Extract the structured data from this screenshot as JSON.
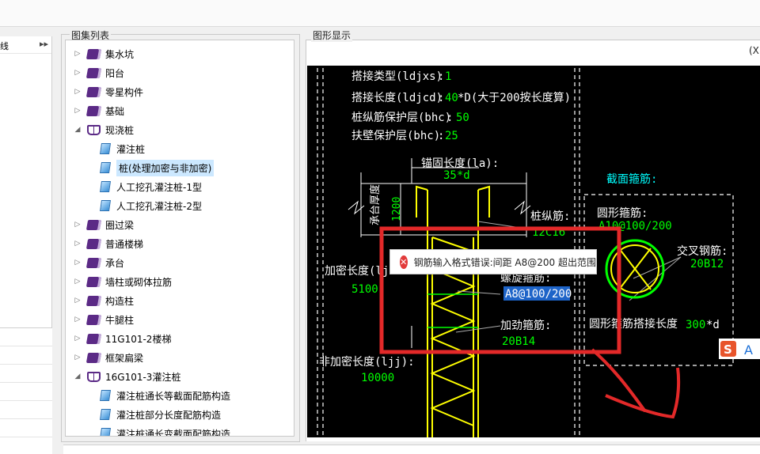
{
  "left_panel": {
    "label": "线",
    "arrow": "▸▸"
  },
  "tree_panel": {
    "title": "图集列表",
    "items": [
      {
        "label": "集水坑",
        "type": "folder",
        "expanded": false
      },
      {
        "label": "阳台",
        "type": "folder",
        "expanded": false
      },
      {
        "label": "零星构件",
        "type": "folder",
        "expanded": false
      },
      {
        "label": "基础",
        "type": "folder",
        "expanded": false
      },
      {
        "label": "现浇桩",
        "type": "folder",
        "expanded": true
      },
      {
        "label": "灌注桩",
        "type": "page"
      },
      {
        "label": "桩(处理加密与非加密)",
        "type": "page",
        "selected": true
      },
      {
        "label": "人工挖孔灌注桩-1型",
        "type": "page"
      },
      {
        "label": "人工挖孔灌注桩-2型",
        "type": "page"
      },
      {
        "label": "圈过梁",
        "type": "folder",
        "expanded": false
      },
      {
        "label": "普通楼梯",
        "type": "folder",
        "expanded": false
      },
      {
        "label": "承台",
        "type": "folder",
        "expanded": false
      },
      {
        "label": "墙柱或砌体拉筋",
        "type": "folder",
        "expanded": false
      },
      {
        "label": "构造柱",
        "type": "folder",
        "expanded": false
      },
      {
        "label": "牛腿柱",
        "type": "folder",
        "expanded": false
      },
      {
        "label": "11G101-2楼梯",
        "type": "folder",
        "expanded": false
      },
      {
        "label": "框架扁梁",
        "type": "folder",
        "expanded": false
      },
      {
        "label": "16G101-3灌注桩",
        "type": "folder",
        "expanded": true
      },
      {
        "label": "灌注桩通长等截面配筋构造",
        "type": "page"
      },
      {
        "label": "灌注桩部分长度配筋构造",
        "type": "page"
      },
      {
        "label": "灌注桩通长变截面配筋构造",
        "type": "page"
      }
    ]
  },
  "graphic_panel": {
    "title": "图形显示",
    "corner_label": "(X",
    "params": [
      {
        "label": "搭接类型(ldjxs)",
        "sep": ":",
        "value": "1"
      },
      {
        "label": "搭接长度(ldjcd)",
        "sep": ":",
        "value": "40",
        "suffix": "*D(大于200按长度算)"
      },
      {
        "label": "桩纵筋保护层(bhc)",
        "sep": ":",
        "value": "50"
      },
      {
        "label": "扶壁保护层(bhc)",
        "sep": ":",
        "value": "25"
      }
    ],
    "anchor_label": "锚固长度(la):",
    "anchor_value": "35*d",
    "cap_label": "承台厚度",
    "cap_value": "1200",
    "long_bar_label": "桩纵筋:",
    "long_bar_value": "12C16",
    "section_label": "截面箍筋:",
    "circle_stirrup_label": "圆形箍筋:",
    "circle_stirrup_value": "A10@100/200",
    "cross_bar_label": "交叉钢筋:",
    "cross_bar_value": "20B12",
    "dense_label": "加密长度(lj",
    "dense_value": "5100",
    "spiral_label": "螺旋箍筋:",
    "spiral_value": "A8@100/200",
    "stiff_label": "加劲箍筋:",
    "stiff_value": "20B14",
    "lap_label": "圆形箍筋搭接长度",
    "lap_value": "300",
    "lap_suffix": "*d",
    "nondense_label": "非加密长度(ljj):",
    "nondense_value": "10000"
  },
  "tooltip": {
    "message": "钢筋输入格式错误:间距 A8@200 超出范围"
  },
  "ime_badge": {
    "letter1": "S",
    "letter2": "A"
  },
  "colors": {
    "canvas": "#000000",
    "text": "#ffffff",
    "value": "#00ff00",
    "rebar": "#ffff00",
    "section_title": "#00ffff",
    "annotation": "#e32929",
    "tree_selected": "#cce8ff"
  }
}
